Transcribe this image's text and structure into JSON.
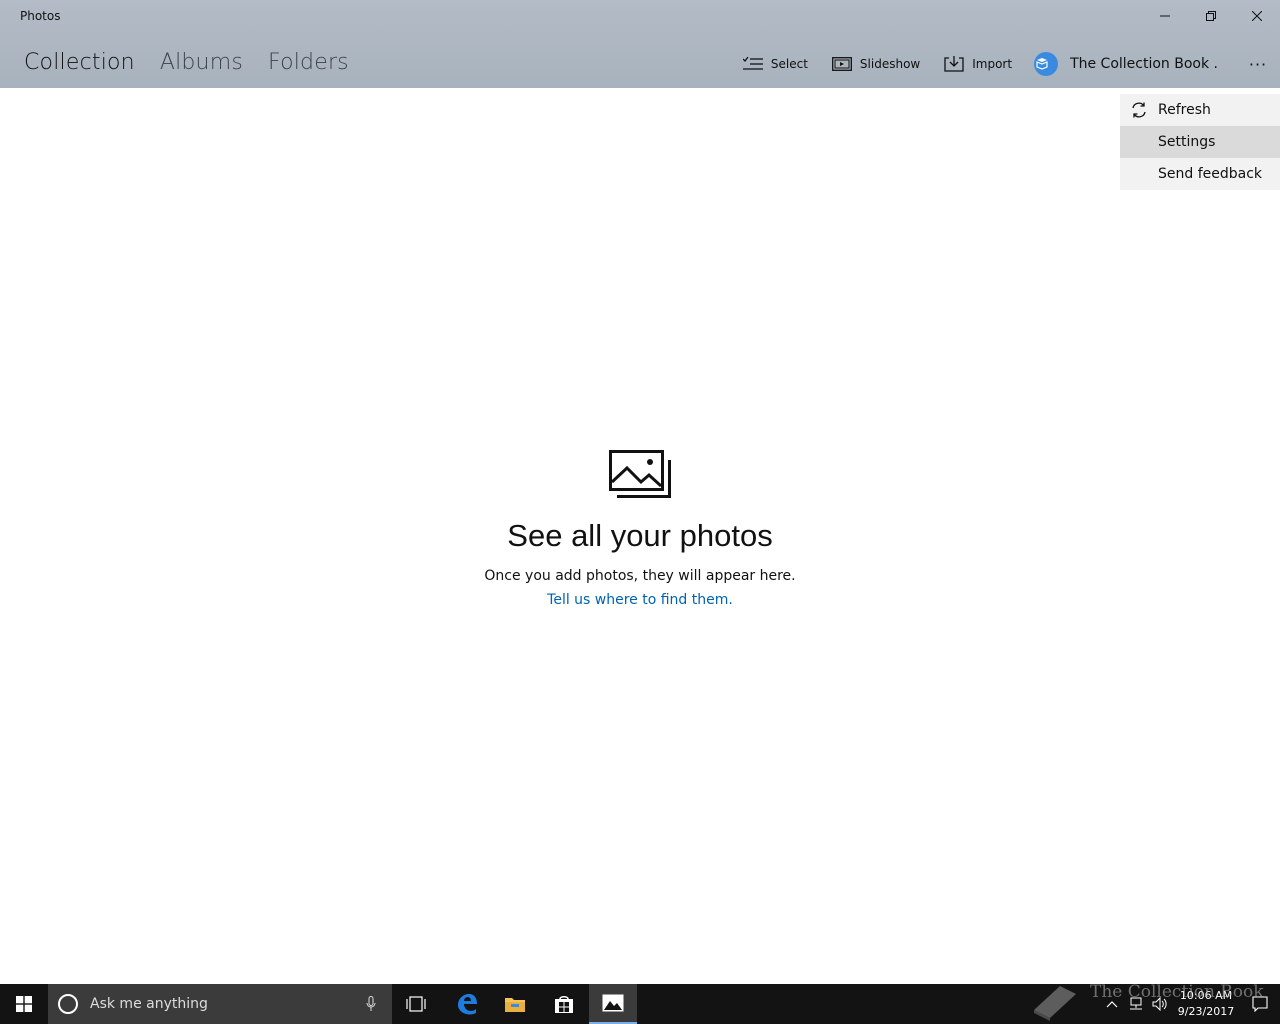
{
  "window": {
    "title": "Photos"
  },
  "nav": {
    "tabs": [
      {
        "label": "Collection",
        "active": true
      },
      {
        "label": "Albums",
        "active": false
      },
      {
        "label": "Folders",
        "active": false
      }
    ]
  },
  "toolbar": {
    "select_label": "Select",
    "slideshow_label": "Slideshow",
    "import_label": "Import",
    "account_label": "The Collection Book .",
    "more_label": "···"
  },
  "menu": {
    "items": [
      {
        "label": "Refresh",
        "icon": "refresh-icon"
      },
      {
        "label": "Settings",
        "hover": true
      },
      {
        "label": "Send feedback"
      }
    ]
  },
  "empty_state": {
    "title": "See all your photos",
    "subtitle": "Once you add photos, they will appear here.",
    "link": "Tell us where to find them."
  },
  "taskbar": {
    "search_placeholder": "Ask me anything",
    "time": "10:06 AM",
    "date": "9/23/2017",
    "watermark": "The Collection Book"
  },
  "colors": {
    "header_bg": "#aeb7c1",
    "link": "#0063b1",
    "taskbar_bg": "#131313",
    "account_avatar": "#3a8be0"
  }
}
